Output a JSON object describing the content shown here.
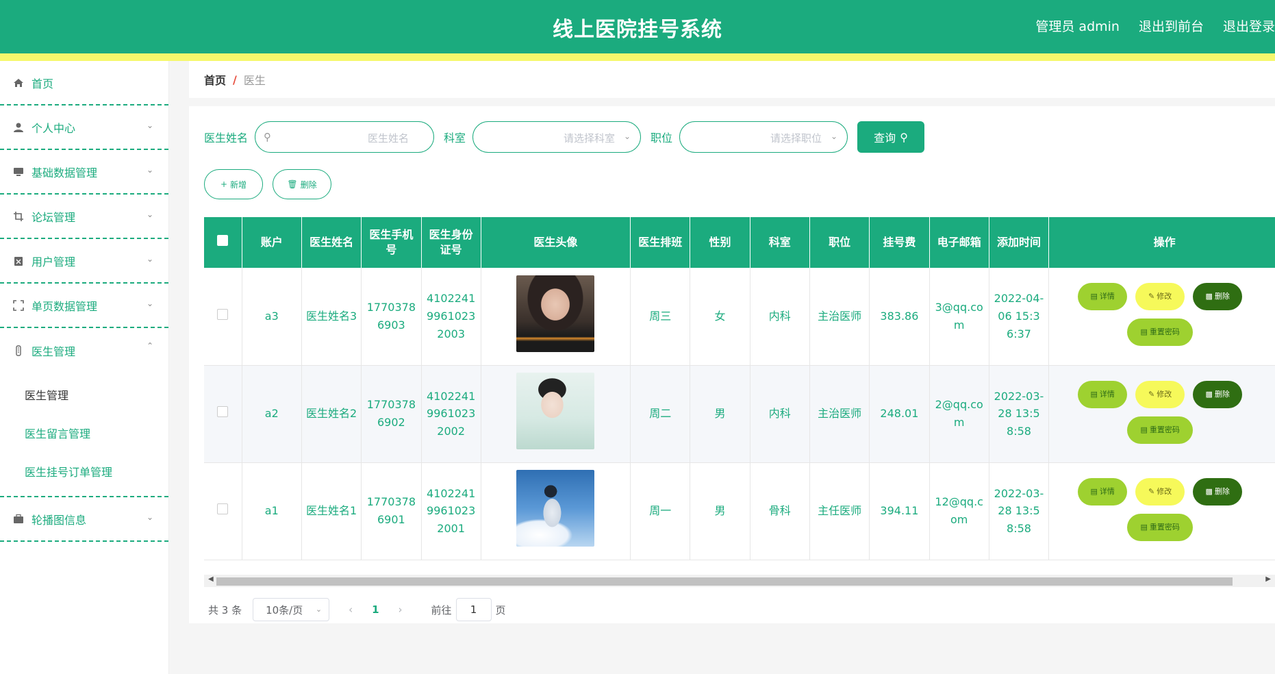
{
  "header": {
    "title": "线上医院挂号系统",
    "admin": "管理员 admin",
    "to_front": "退出到前台",
    "logout": "退出登录"
  },
  "sidebar": {
    "items": [
      {
        "label": "首页",
        "icon": "home-icon"
      },
      {
        "label": "个人中心",
        "icon": "user-icon"
      },
      {
        "label": "基础数据管理",
        "icon": "monitor-icon"
      },
      {
        "label": "论坛管理",
        "icon": "crop-icon"
      },
      {
        "label": "用户管理",
        "icon": "clipboard-icon"
      },
      {
        "label": "单页数据管理",
        "icon": "fullscreen-icon"
      },
      {
        "label": "医生管理",
        "icon": "thermometer-icon"
      },
      {
        "label": "轮播图信息",
        "icon": "briefcase-icon"
      }
    ],
    "submenu": [
      "医生管理",
      "医生留言管理",
      "医生挂号订单管理"
    ]
  },
  "breadcrumb": {
    "home": "首页",
    "sep": "/",
    "current": "医生"
  },
  "search": {
    "name_label": "医生姓名",
    "name_placeholder": "医生姓名",
    "dept_label": "科室",
    "dept_placeholder": "请选择科室",
    "title_label": "职位",
    "title_placeholder": "请选择职位",
    "query_button": "查询"
  },
  "actions": {
    "add": "新增",
    "delete": "删除"
  },
  "table": {
    "columns": [
      "账户",
      "医生姓名",
      "医生手机号",
      "医生身份证号",
      "医生头像",
      "医生排班",
      "性别",
      "科室",
      "职位",
      "挂号费",
      "电子邮箱",
      "添加时间",
      "操作"
    ],
    "rows": [
      {
        "account": "a3",
        "name": "医生姓名3",
        "phone": "17703786903",
        "idcard": "410224199610232003",
        "avatar": "avatar-woman-dark-hair",
        "schedule": "周三",
        "gender": "女",
        "dept": "内科",
        "title": "主治医师",
        "fee": "383.86",
        "email": "3@qq.com",
        "time": "2022-04-06 15:36:37"
      },
      {
        "account": "a2",
        "name": "医生姓名2",
        "phone": "17703786902",
        "idcard": "410224199610232002",
        "avatar": "avatar-woman-updo",
        "schedule": "周二",
        "gender": "男",
        "dept": "内科",
        "title": "主治医师",
        "fee": "248.01",
        "email": "2@qq.com",
        "time": "2022-03-28 13:58:58"
      },
      {
        "account": "a1",
        "name": "医生姓名1",
        "phone": "17703786901",
        "idcard": "410224199610232001",
        "avatar": "avatar-anime-sky",
        "schedule": "周一",
        "gender": "男",
        "dept": "骨科",
        "title": "主任医师",
        "fee": "394.11",
        "email": "12@qq.com",
        "time": "2022-03-28 13:58:58"
      }
    ],
    "op_labels": {
      "detail": "详情",
      "edit": "修改",
      "delete": "删除",
      "reset": "重置密码"
    }
  },
  "pager": {
    "total": "共 3 条",
    "page_size": "10条/页",
    "current": "1",
    "goto_label": "前往",
    "goto_value": "1",
    "page_unit": "页"
  },
  "colors": {
    "primary": "#1bab7e",
    "accent_bar": "#f5f76c",
    "detail_btn": "#9ed130",
    "edit_btn": "#f6f95a",
    "delete_btn": "#2f6e12"
  }
}
